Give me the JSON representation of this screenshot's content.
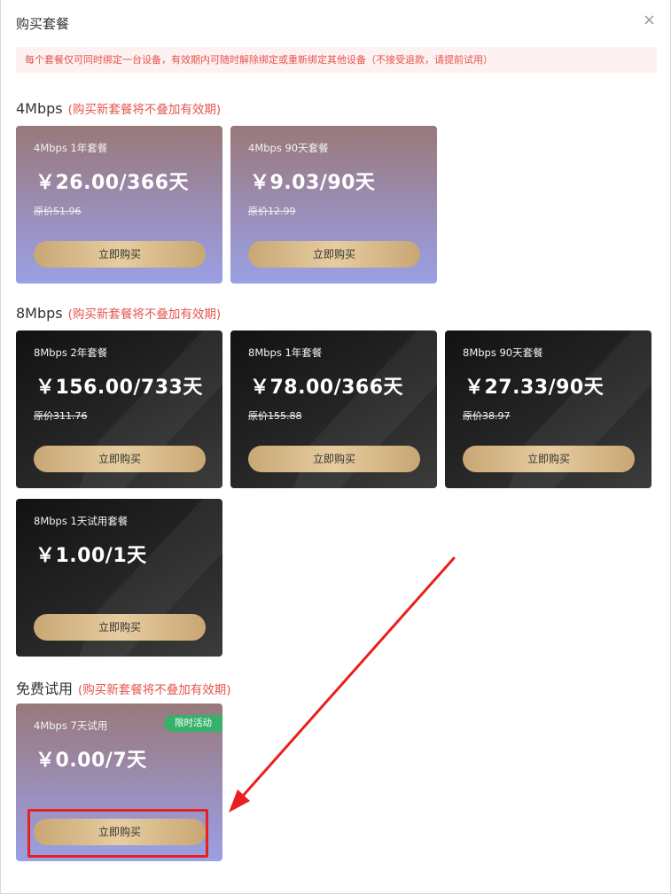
{
  "dialog": {
    "title": "购买套餐",
    "close_glyph": "×",
    "notice": "每个套餐仅可同时绑定一台设备，有效期内可随时解除绑定或重新绑定其他设备（不接受退款，请提前试用）"
  },
  "sections": [
    {
      "name": "4Mbps",
      "note": "(购买新套餐将不叠加有效期)",
      "plans": [
        {
          "name": "4Mbps 1年套餐",
          "price": "￥26.00/366天",
          "original": "原价51.96",
          "buy": "立即购买"
        },
        {
          "name": "4Mbps 90天套餐",
          "price": "￥9.03/90天",
          "original": "原价12.99",
          "buy": "立即购买"
        }
      ]
    },
    {
      "name": "8Mbps",
      "note": "(购买新套餐将不叠加有效期)",
      "plans": [
        {
          "name": "8Mbps 2年套餐",
          "price": "￥156.00/733天",
          "original": "原价311.76",
          "buy": "立即购买"
        },
        {
          "name": "8Mbps 1年套餐",
          "price": "￥78.00/366天",
          "original": "原价155.88",
          "buy": "立即购买"
        },
        {
          "name": "8Mbps 90天套餐",
          "price": "￥27.33/90天",
          "original": "原价38.97",
          "buy": "立即购买"
        },
        {
          "name": "8Mbps 1天试用套餐",
          "price": "￥1.00/1天",
          "original": "",
          "buy": "立即购买"
        }
      ]
    },
    {
      "name": "免费试用",
      "note": "(购买新套餐将不叠加有效期)",
      "plans": [
        {
          "name": "4Mbps 7天试用",
          "price": "￥0.00/7天",
          "original": "",
          "buy": "立即购买",
          "badge": "限时活动"
        }
      ]
    }
  ],
  "colors": {
    "accent_red": "#e5544c",
    "badge_green": "#37b26c",
    "annotation_red": "#e8201e"
  }
}
